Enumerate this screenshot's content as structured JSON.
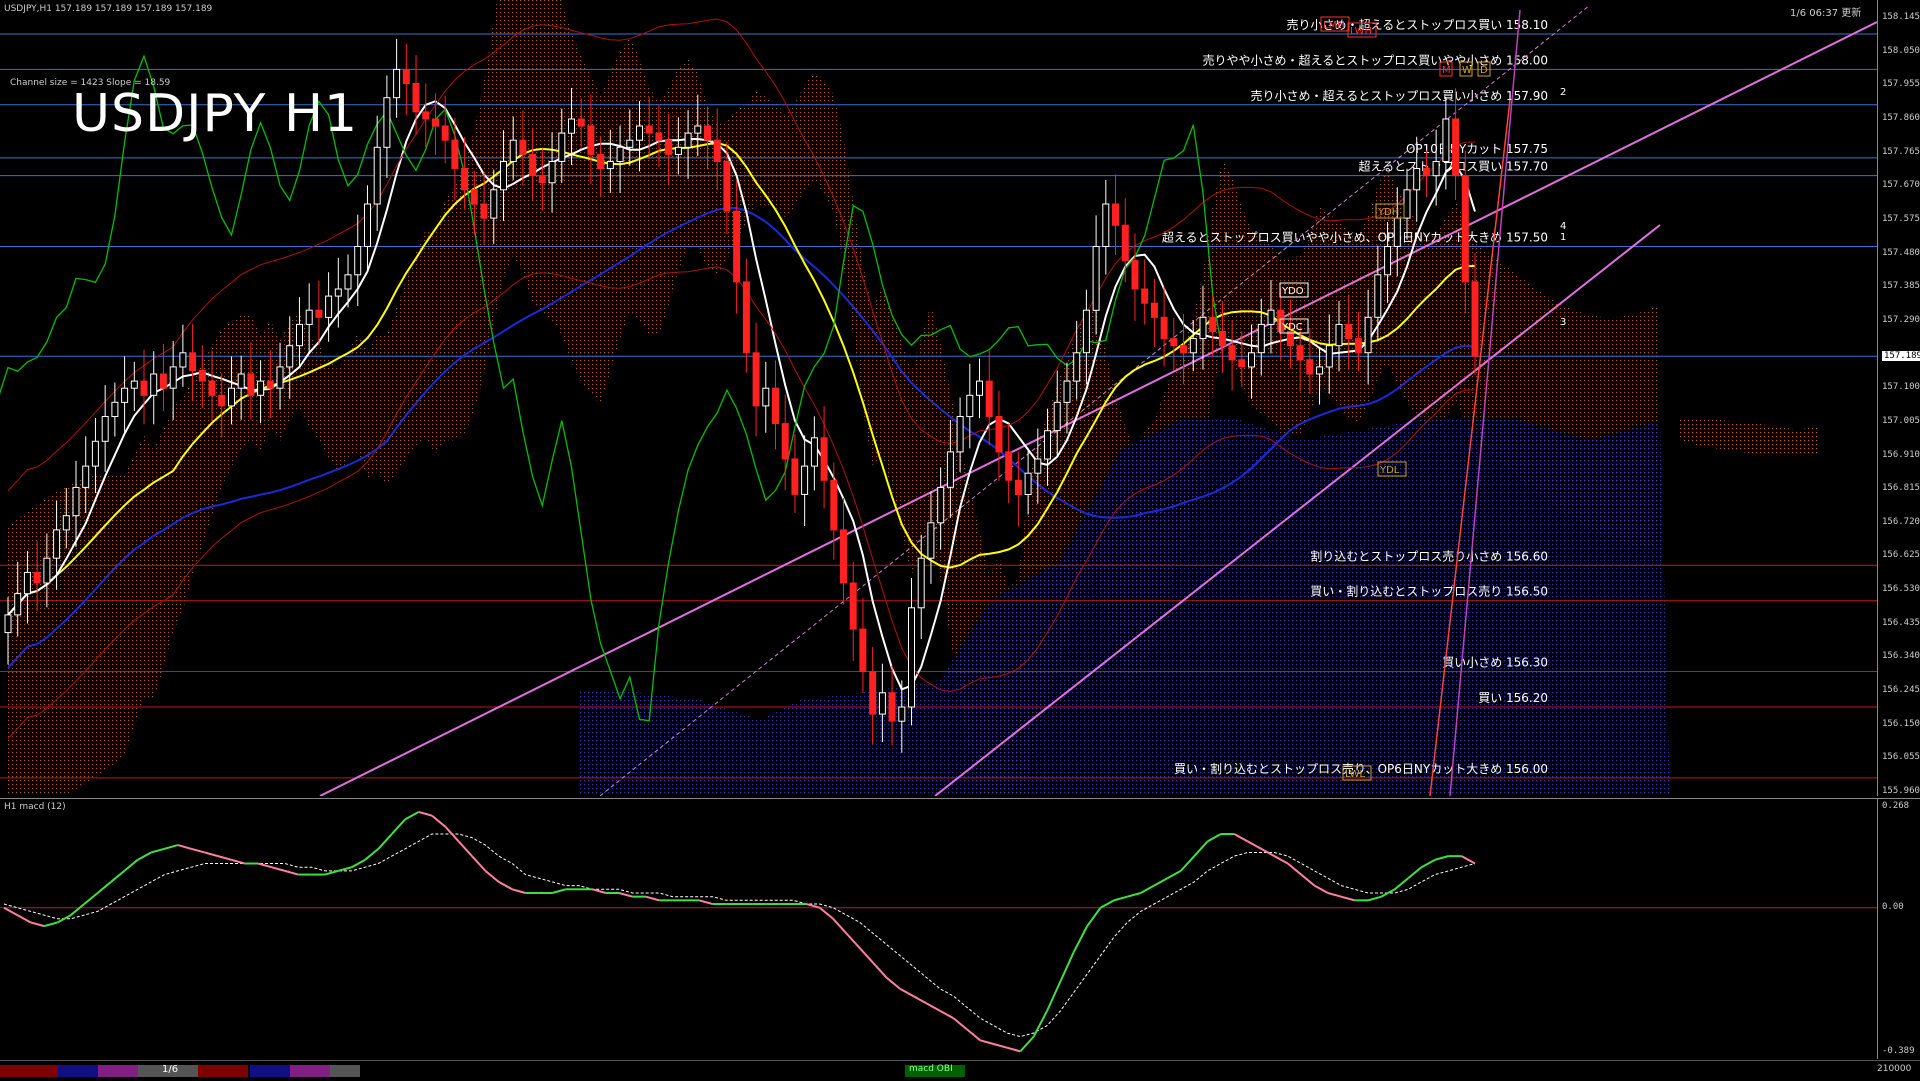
{
  "header": {
    "symbol_info": "USDJPY,H1  157.189 157.189 157.189 157.189",
    "timestamp": "1/6 06:37 更新",
    "channel_info": "Channel size = 1423 Slope = 18.59",
    "title": "USDJPY H1"
  },
  "macd": {
    "label": "H1 macd (12)",
    "axis_labels": [
      "0.268",
      "0.00",
      "-0.389"
    ]
  },
  "price_axis": [
    "158.145",
    "158.050",
    "157.955",
    "157.860",
    "157.765",
    "157.670",
    "157.575",
    "157.480",
    "157.385",
    "157.290",
    "157.189",
    "157.100",
    "157.005",
    "156.910",
    "156.815",
    "156.720",
    "156.625",
    "156.530",
    "156.435",
    "156.340",
    "156.245",
    "156.150",
    "156.055",
    "155.960"
  ],
  "current_price": "157.189",
  "bottom_bar": {
    "page_indicator": "1/6",
    "macd_tab": "macd OBI",
    "right_value": "210000"
  },
  "colors": {
    "candle_up": "#ffffff",
    "candle_down": "#ff2020",
    "level_blue": "#3a6fd8",
    "level_red": "#c01818",
    "channel": "#e070e0",
    "ma_short": "#ffffff",
    "ma_mid": "#ffff00",
    "ma_long": "#1a2ad8",
    "span": "#00c000",
    "macd_up": "#40e040",
    "macd_down": "#ff80a0",
    "signal": "#ffffff",
    "cloud_blue": "#1a1aa0",
    "cloud_orange": "#c06020"
  },
  "chart_data": {
    "type": "candlestick",
    "title": "USDJPY H1",
    "ylim": [
      155.96,
      158.145
    ],
    "levels": [
      {
        "price": 158.1,
        "label": "売り小さめ・超えるとストップロス買い 158.10",
        "kind": "sell"
      },
      {
        "price": 158.0,
        "label": "売りやや小さめ・超えるとストップロス買いやや小さめ 158.00",
        "kind": "sell"
      },
      {
        "price": 157.9,
        "label": "売り小さめ・超えるとストップロス買い小さめ 157.90",
        "kind": "sell"
      },
      {
        "price": 157.75,
        "label": "OP10日NYカット 157.75",
        "kind": "sell"
      },
      {
        "price": 157.7,
        "label": "超えるとストップロス買い 157.70",
        "kind": "sell"
      },
      {
        "price": 157.5,
        "label": "超えるとストップロス買いやや小さめ、OP6日NYカット大きめ 157.50",
        "kind": "sell"
      },
      {
        "price": 156.6,
        "label": "割り込むとストップロス売り小さめ 156.60",
        "kind": "buy"
      },
      {
        "price": 156.5,
        "label": "買い・割り込むとストップロス売り 156.50",
        "kind": "buy"
      },
      {
        "price": 156.3,
        "label": "買い小さめ 156.30",
        "kind": "buy"
      },
      {
        "price": 156.2,
        "label": "買い 156.20",
        "kind": "buy"
      },
      {
        "price": 156.0,
        "label": "買い・割り込むとストップロス売り、OP6日NYカット大きめ 156.00",
        "kind": "buy"
      }
    ],
    "extra_levels": [
      157.19
    ],
    "markers": [
      "LMH",
      "LWH",
      "M",
      "W",
      "D",
      "YDH",
      "YDO",
      "YDC",
      "YDL",
      "LWL",
      "1",
      "2",
      "3",
      "4"
    ],
    "closes": [
      156.46,
      156.52,
      156.58,
      156.55,
      156.62,
      156.7,
      156.74,
      156.82,
      156.88,
      156.95,
      157.02,
      157.06,
      157.1,
      157.12,
      157.08,
      157.14,
      157.1,
      157.16,
      157.2,
      157.15,
      157.12,
      157.08,
      157.05,
      157.1,
      157.14,
      157.08,
      157.12,
      157.1,
      157.16,
      157.22,
      157.28,
      157.32,
      157.3,
      157.36,
      157.38,
      157.42,
      157.5,
      157.62,
      157.78,
      157.92,
      158.0,
      157.96,
      157.88,
      157.86,
      157.84,
      157.8,
      157.72,
      157.66,
      157.62,
      157.58,
      157.66,
      157.74,
      157.8,
      157.76,
      157.7,
      157.68,
      157.74,
      157.82,
      157.86,
      157.84,
      157.76,
      157.72,
      157.74,
      157.78,
      157.8,
      157.84,
      157.82,
      157.8,
      157.76,
      157.78,
      157.82,
      157.84,
      157.8,
      157.74,
      157.6,
      157.4,
      157.2,
      157.05,
      157.1,
      157.0,
      156.9,
      156.8,
      156.88,
      156.96,
      156.84,
      156.7,
      156.55,
      156.42,
      156.3,
      156.18,
      156.24,
      156.16,
      156.2,
      156.48,
      156.62,
      156.72,
      156.82,
      156.92,
      157.02,
      157.08,
      157.12,
      157.02,
      156.92,
      156.84,
      156.8,
      156.86,
      156.9,
      156.98,
      157.06,
      157.12,
      157.2,
      157.32,
      157.5,
      157.62,
      157.56,
      157.46,
      157.38,
      157.34,
      157.3,
      157.24,
      157.22,
      157.2,
      157.24,
      157.3,
      157.26,
      157.22,
      157.18,
      157.16,
      157.2,
      157.28,
      157.32,
      157.26,
      157.22,
      157.18,
      157.14,
      157.16,
      157.22,
      157.28,
      157.24,
      157.2,
      157.3,
      157.42,
      157.5,
      157.58,
      157.66,
      157.72,
      157.7,
      157.74,
      157.86,
      157.7,
      157.4,
      157.19
    ],
    "macd_values": [
      0.0,
      -0.02,
      -0.04,
      -0.05,
      -0.04,
      -0.02,
      0.01,
      0.04,
      0.07,
      0.1,
      0.13,
      0.15,
      0.16,
      0.17,
      0.16,
      0.15,
      0.14,
      0.13,
      0.12,
      0.12,
      0.11,
      0.1,
      0.09,
      0.09,
      0.09,
      0.1,
      0.11,
      0.13,
      0.16,
      0.2,
      0.24,
      0.26,
      0.25,
      0.22,
      0.18,
      0.14,
      0.1,
      0.07,
      0.05,
      0.04,
      0.04,
      0.04,
      0.05,
      0.05,
      0.05,
      0.04,
      0.04,
      0.03,
      0.03,
      0.02,
      0.02,
      0.02,
      0.02,
      0.01,
      0.01,
      0.01,
      0.01,
      0.01,
      0.01,
      0.01,
      0.01,
      0.0,
      -0.03,
      -0.07,
      -0.11,
      -0.15,
      -0.19,
      -0.22,
      -0.24,
      -0.26,
      -0.28,
      -0.3,
      -0.33,
      -0.36,
      -0.37,
      -0.38,
      -0.39,
      -0.35,
      -0.28,
      -0.2,
      -0.12,
      -0.05,
      0.0,
      0.02,
      0.03,
      0.04,
      0.06,
      0.08,
      0.1,
      0.14,
      0.18,
      0.2,
      0.2,
      0.18,
      0.16,
      0.14,
      0.12,
      0.09,
      0.06,
      0.04,
      0.03,
      0.02,
      0.02,
      0.03,
      0.05,
      0.08,
      0.11,
      0.13,
      0.14,
      0.14,
      0.12
    ],
    "signal_values": [
      0.01,
      0.0,
      -0.01,
      -0.02,
      -0.03,
      -0.03,
      -0.02,
      -0.01,
      0.01,
      0.03,
      0.05,
      0.07,
      0.09,
      0.1,
      0.11,
      0.12,
      0.12,
      0.12,
      0.12,
      0.12,
      0.12,
      0.12,
      0.11,
      0.11,
      0.1,
      0.1,
      0.1,
      0.11,
      0.12,
      0.14,
      0.16,
      0.18,
      0.2,
      0.2,
      0.2,
      0.19,
      0.17,
      0.14,
      0.12,
      0.09,
      0.08,
      0.07,
      0.06,
      0.06,
      0.05,
      0.05,
      0.05,
      0.04,
      0.04,
      0.04,
      0.03,
      0.03,
      0.03,
      0.03,
      0.02,
      0.02,
      0.02,
      0.02,
      0.02,
      0.02,
      0.01,
      0.01,
      0.0,
      -0.02,
      -0.04,
      -0.07,
      -0.1,
      -0.13,
      -0.16,
      -0.19,
      -0.22,
      -0.24,
      -0.27,
      -0.3,
      -0.32,
      -0.34,
      -0.35,
      -0.34,
      -0.32,
      -0.28,
      -0.23,
      -0.18,
      -0.13,
      -0.08,
      -0.04,
      -0.01,
      0.01,
      0.03,
      0.05,
      0.07,
      0.1,
      0.12,
      0.14,
      0.15,
      0.15,
      0.15,
      0.14,
      0.12,
      0.1,
      0.08,
      0.06,
      0.05,
      0.04,
      0.04,
      0.04,
      0.05,
      0.07,
      0.09,
      0.1,
      0.11,
      0.12
    ]
  }
}
